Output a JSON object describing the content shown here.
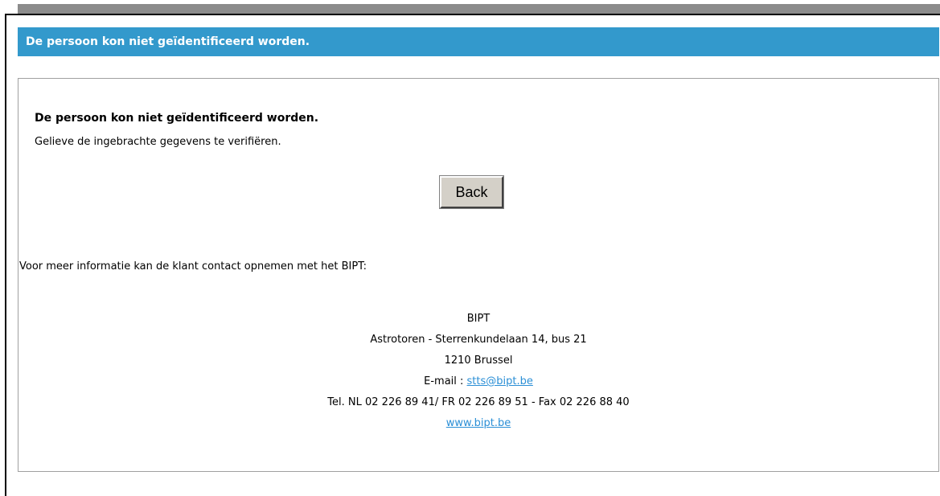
{
  "colors": {
    "title_bar_bg": "#3399cc",
    "title_bar_text": "#ffffff",
    "link": "#2b8fd6",
    "top_bar": "#8c8c8c"
  },
  "header": {
    "title": "De persoon kon niet geïdentificeerd worden."
  },
  "message": {
    "heading": "De persoon kon niet geïdentificeerd worden.",
    "subtext": "Gelieve de ingebrachte gegevens te verifiëren."
  },
  "actions": {
    "back_label": "Back"
  },
  "info": {
    "intro": "Voor meer informatie kan de klant contact opnemen met het BIPT:"
  },
  "contact": {
    "org": "BIPT",
    "address_line": "Astrotoren - Sterrenkundelaan 14, bus 21",
    "city_line": "1210 Brussel",
    "email_label": "E-mail : ",
    "email": "stts@bipt.be",
    "phone_line": "Tel. NL 02 226 89 41/ FR 02 226 89 51 - Fax 02 226 88 40",
    "website": "www.bipt.be"
  }
}
